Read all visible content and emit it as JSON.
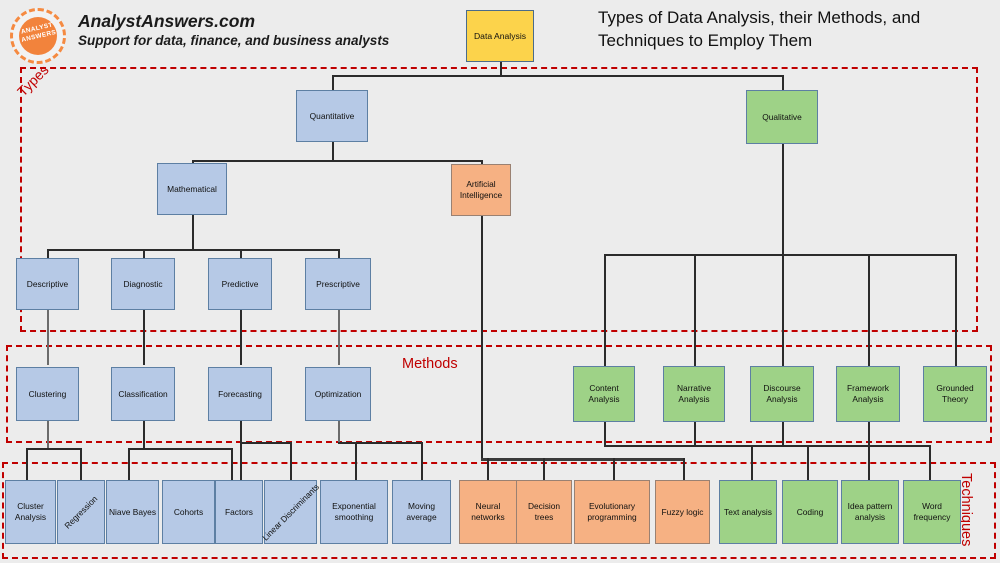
{
  "header": {
    "logo_icon": "analyst-answers-circle-logo",
    "logo_line1": "ANALYST",
    "logo_line2": "ANSWERS",
    "site_name": "AnalystAnswers.com",
    "tagline": "Support for data, finance, and business analysts",
    "title": "Types of Data Analysis, their Methods, and Techniques to Employ Them"
  },
  "colors": {
    "background": "#ececec",
    "root_fill": "#fcd34b",
    "quantitative_fill": "#b6c9e6",
    "qualitative_fill": "#9ed287",
    "ai_fill": "#f6b183",
    "node_border": "#5d7fa3",
    "frame_border": "#c00000",
    "frame_label": "#c00000",
    "connector": "#2b2b2b"
  },
  "frames": [
    {
      "label": "Types"
    },
    {
      "label": "Methods"
    },
    {
      "label": "Techniques"
    }
  ],
  "chart_data": {
    "type": "diagram",
    "title": "Types of Data Analysis, their Methods, and Techniques to Employ Them",
    "root": "Data Analysis",
    "levels": [
      "Types",
      "Methods",
      "Techniques"
    ],
    "nodes": [
      {
        "id": "root",
        "label": "Data Analysis",
        "band": "Types",
        "color": "#fcd34b"
      },
      {
        "id": "quantitative",
        "label": "Quantitative",
        "band": "Types",
        "color": "#b6c9e6"
      },
      {
        "id": "qualitative",
        "label": "Qualitative",
        "band": "Types",
        "color": "#9ed287"
      },
      {
        "id": "mathematical",
        "label": "Mathematical",
        "band": "Types",
        "color": "#b6c9e6"
      },
      {
        "id": "ai",
        "label": "Artificial Intelligence",
        "band": "Types",
        "color": "#f6b183"
      },
      {
        "id": "descriptive",
        "label": "Descriptive",
        "band": "Types",
        "color": "#b6c9e6"
      },
      {
        "id": "diagnostic",
        "label": "Diagnostic",
        "band": "Types",
        "color": "#b6c9e6"
      },
      {
        "id": "predictive",
        "label": "Predictive",
        "band": "Types",
        "color": "#b6c9e6"
      },
      {
        "id": "prescriptive",
        "label": "Prescriptive",
        "band": "Types",
        "color": "#b6c9e6"
      },
      {
        "id": "clustering",
        "label": "Clustering",
        "band": "Methods",
        "color": "#b6c9e6"
      },
      {
        "id": "classification",
        "label": "Classification",
        "band": "Methods",
        "color": "#b6c9e6"
      },
      {
        "id": "forecasting",
        "label": "Forecasting",
        "band": "Methods",
        "color": "#b6c9e6"
      },
      {
        "id": "optimization",
        "label": "Optimization",
        "band": "Methods",
        "color": "#b6c9e6"
      },
      {
        "id": "content",
        "label": "Content Analysis",
        "band": "Methods",
        "color": "#9ed287"
      },
      {
        "id": "narrative",
        "label": "Narrative Analysis",
        "band": "Methods",
        "color": "#9ed287"
      },
      {
        "id": "discourse",
        "label": "Discourse Analysis",
        "band": "Methods",
        "color": "#9ed287"
      },
      {
        "id": "framework",
        "label": "Framework Analysis",
        "band": "Methods",
        "color": "#9ed287"
      },
      {
        "id": "grounded",
        "label": "Grounded Theory",
        "band": "Methods",
        "color": "#9ed287"
      },
      {
        "id": "cluster_an",
        "label": "Cluster Analysis",
        "band": "Techniques",
        "color": "#b6c9e6"
      },
      {
        "id": "regression",
        "label": "Regression",
        "band": "Techniques",
        "color": "#b6c9e6",
        "rotated": true
      },
      {
        "id": "niave_bayes",
        "label": "Niave Bayes",
        "band": "Techniques",
        "color": "#b6c9e6"
      },
      {
        "id": "cohorts",
        "label": "Cohorts",
        "band": "Techniques",
        "color": "#b6c9e6"
      },
      {
        "id": "factors",
        "label": "Factors",
        "band": "Techniques",
        "color": "#b6c9e6"
      },
      {
        "id": "lin_disc",
        "label": "Linear Discriminants",
        "band": "Techniques",
        "color": "#b6c9e6",
        "rotated": true
      },
      {
        "id": "exp_smooth",
        "label": "Exponential smoothing",
        "band": "Techniques",
        "color": "#b6c9e6"
      },
      {
        "id": "moving_avg",
        "label": "Moving average",
        "band": "Techniques",
        "color": "#b6c9e6"
      },
      {
        "id": "neural",
        "label": "Neural networks",
        "band": "Techniques",
        "color": "#f6b183"
      },
      {
        "id": "dec_trees",
        "label": "Decision trees",
        "band": "Techniques",
        "color": "#f6b183"
      },
      {
        "id": "evo_prog",
        "label": "Evolutionary programming",
        "band": "Techniques",
        "color": "#f6b183"
      },
      {
        "id": "fuzzy",
        "label": "Fuzzy logic",
        "band": "Techniques",
        "color": "#f6b183"
      },
      {
        "id": "text_an",
        "label": "Text analysis",
        "band": "Techniques",
        "color": "#9ed287"
      },
      {
        "id": "coding",
        "label": "Coding",
        "band": "Techniques",
        "color": "#9ed287"
      },
      {
        "id": "idea_pattern",
        "label": "Idea pattern analysis",
        "band": "Techniques",
        "color": "#9ed287"
      },
      {
        "id": "word_freq",
        "label": "Word frequency",
        "band": "Techniques",
        "color": "#9ed287"
      }
    ],
    "edges": [
      [
        "root",
        "quantitative"
      ],
      [
        "root",
        "qualitative"
      ],
      [
        "quantitative",
        "mathematical"
      ],
      [
        "quantitative",
        "ai"
      ],
      [
        "mathematical",
        "descriptive"
      ],
      [
        "mathematical",
        "diagnostic"
      ],
      [
        "mathematical",
        "predictive"
      ],
      [
        "mathematical",
        "prescriptive"
      ],
      [
        "descriptive",
        "clustering"
      ],
      [
        "diagnostic",
        "classification"
      ],
      [
        "predictive",
        "forecasting"
      ],
      [
        "prescriptive",
        "optimization"
      ],
      [
        "qualitative",
        "content"
      ],
      [
        "qualitative",
        "narrative"
      ],
      [
        "qualitative",
        "discourse"
      ],
      [
        "qualitative",
        "framework"
      ],
      [
        "qualitative",
        "grounded"
      ],
      [
        "clustering",
        "cluster_an"
      ],
      [
        "clustering",
        "regression"
      ],
      [
        "classification",
        "niave_bayes"
      ],
      [
        "classification",
        "cohorts"
      ],
      [
        "forecasting",
        "factors"
      ],
      [
        "forecasting",
        "lin_disc"
      ],
      [
        "optimization",
        "exp_smooth"
      ],
      [
        "optimization",
        "moving_avg"
      ],
      [
        "ai",
        "neural"
      ],
      [
        "ai",
        "dec_trees"
      ],
      [
        "ai",
        "evo_prog"
      ],
      [
        "ai",
        "fuzzy"
      ],
      [
        "content",
        "text_an"
      ],
      [
        "narrative",
        "coding"
      ],
      [
        "discourse",
        "idea_pattern"
      ],
      [
        "framework",
        "word_freq"
      ]
    ]
  }
}
